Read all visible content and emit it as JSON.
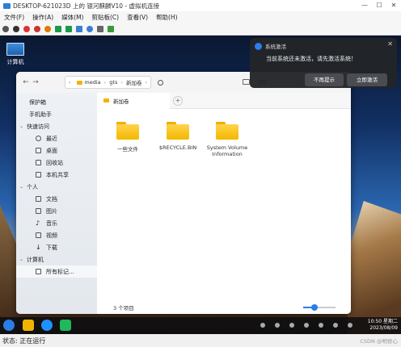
{
  "host": {
    "title": "DESKTOP-621023D 上的 银河麒麟V10 - 虚拟机连接",
    "menu": [
      "文件(F)",
      "操作(A)",
      "媒体(M)",
      "剪贴板(C)",
      "查看(V)",
      "帮助(H)"
    ],
    "status": "状态: 正在运行",
    "watermark": "CSDN @明修心"
  },
  "desktop": {
    "icons": [
      {
        "label": "计算机"
      }
    ]
  },
  "file_manager": {
    "breadcrumb": [
      "media",
      "gts",
      "新加卷"
    ],
    "tab_label": "新加卷",
    "sidebar": {
      "top_items": [
        "保护箱",
        "手机助手"
      ],
      "quick_access": {
        "label": "快速访问",
        "items": [
          "最近",
          "桌面",
          "回收站",
          "本机共享"
        ]
      },
      "personal": {
        "label": "个人",
        "items": [
          "文档",
          "图片",
          "音乐",
          "视频",
          "下载"
        ]
      },
      "computer": {
        "label": "计算机",
        "items": [
          "所有标记..."
        ]
      }
    },
    "files": [
      {
        "name": "一些文件"
      },
      {
        "name": "$RECYCLE.BIN"
      },
      {
        "name": "System Volume Information"
      }
    ],
    "status": "3 个项目",
    "zoom_level": 0.35
  },
  "notification": {
    "title": "系统激活",
    "message": "当前系统还未激活，请先激活系统！",
    "dismiss_label": "不再提示",
    "activate_label": "立即激活"
  },
  "taskbar": {
    "time": "10:50 星期二",
    "date": "2023/08/09"
  },
  "colors": {
    "accent": "#2b7de9",
    "folder": "#f4b800"
  }
}
